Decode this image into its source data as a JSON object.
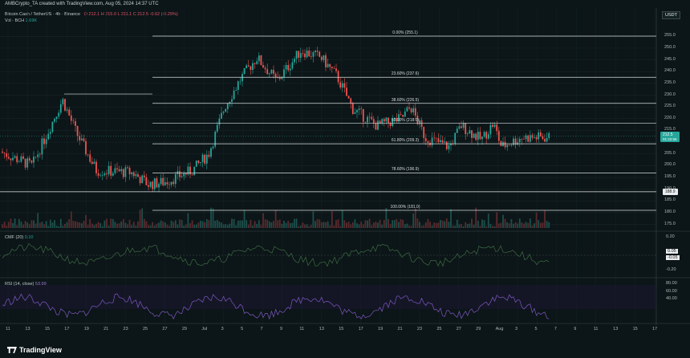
{
  "header": {
    "created_by": "AMBCrypto_TA created with TradingView.com, Aug 05, 2024 14:37 UTC"
  },
  "legend": {
    "symbol": "Bitcoin Cash / TetherUS · 4h · Binance",
    "ohlc": "O 212.1  H 215.0  L 211.1  C 212.5  -0.62 (-0.29%)",
    "volume_label": "Vol · BCH",
    "volume_value": "2.69K",
    "cmf_label": "CMF (20)",
    "cmf_value": "0.10",
    "rsi_label": "RSI (14, close)",
    "rsi_value": "53.99"
  },
  "currency_button": "USDT",
  "fib_levels": [
    {
      "label": "0.00% (255.1)",
      "price": 255.1
    },
    {
      "label": "23.60% (237.6)",
      "price": 237.6
    },
    {
      "label": "38.60% (226.5)",
      "price": 226.5
    },
    {
      "label": "50.00% (218.0)",
      "price": 218.0
    },
    {
      "label": "61.80% (209.3)",
      "price": 209.3
    },
    {
      "label": "78.60% (196.9)",
      "price": 196.9
    },
    {
      "label": "100.00% (181.0)",
      "price": 181.0
    }
  ],
  "price_axis": [
    "255.0",
    "250.0",
    "245.0",
    "240.0",
    "235.0",
    "230.0",
    "225.0",
    "220.0",
    "215.0",
    "210.0",
    "205.0",
    "200.0",
    "195.0",
    "190.0",
    "185.0",
    "180.0",
    "175.0"
  ],
  "current_price": {
    "price": 212.5,
    "label": "212.5",
    "sub": "01:22:56"
  },
  "support_price": {
    "price": 188.9,
    "label": "188.9"
  },
  "cmf_axis": [
    "0.20",
    "0.05",
    "-0.05",
    "-0.20"
  ],
  "rsi_axis": [
    "80.00",
    "60.00",
    "40.00"
  ],
  "time_axis": [
    "11",
    "13",
    "15",
    "17",
    "19",
    "21",
    "23",
    "25",
    "27",
    "29",
    "Jul",
    "3",
    "5",
    "7",
    "9",
    "11",
    "13",
    "15",
    "17",
    "19",
    "21",
    "23",
    "25",
    "27",
    "29",
    "Aug",
    "3",
    "5",
    "7",
    "9",
    "11",
    "13",
    "15",
    "17"
  ],
  "footer": {
    "brand": "TradingView"
  },
  "colors": {
    "up": "#26a69a",
    "down": "#ef5350",
    "background": "#0c1517",
    "fib_line": "#d6dde0",
    "cmf": "#3d6b45",
    "rsi": "#7e57c2"
  }
}
